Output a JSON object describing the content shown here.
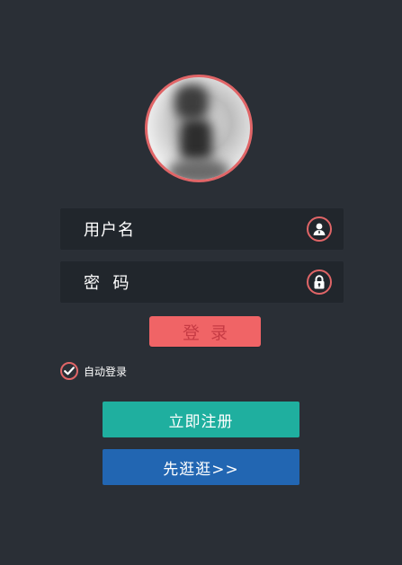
{
  "colors": {
    "background": "#2a2f36",
    "field_background": "#21262c",
    "accent_red": "#e06567",
    "login_button": "#f06466",
    "register_button": "#1faf9f",
    "browse_button": "#2266b2"
  },
  "avatar": {
    "icon": "user-photo"
  },
  "form": {
    "username": {
      "label": "用户名",
      "icon": "user-icon"
    },
    "password": {
      "label": "密  码",
      "icon": "lock-icon"
    },
    "login_label": "登录",
    "remember_label": "自动登录",
    "remember_checked": true
  },
  "actions": {
    "register_label": "立即注册",
    "browse_label": "先逛逛>>"
  }
}
